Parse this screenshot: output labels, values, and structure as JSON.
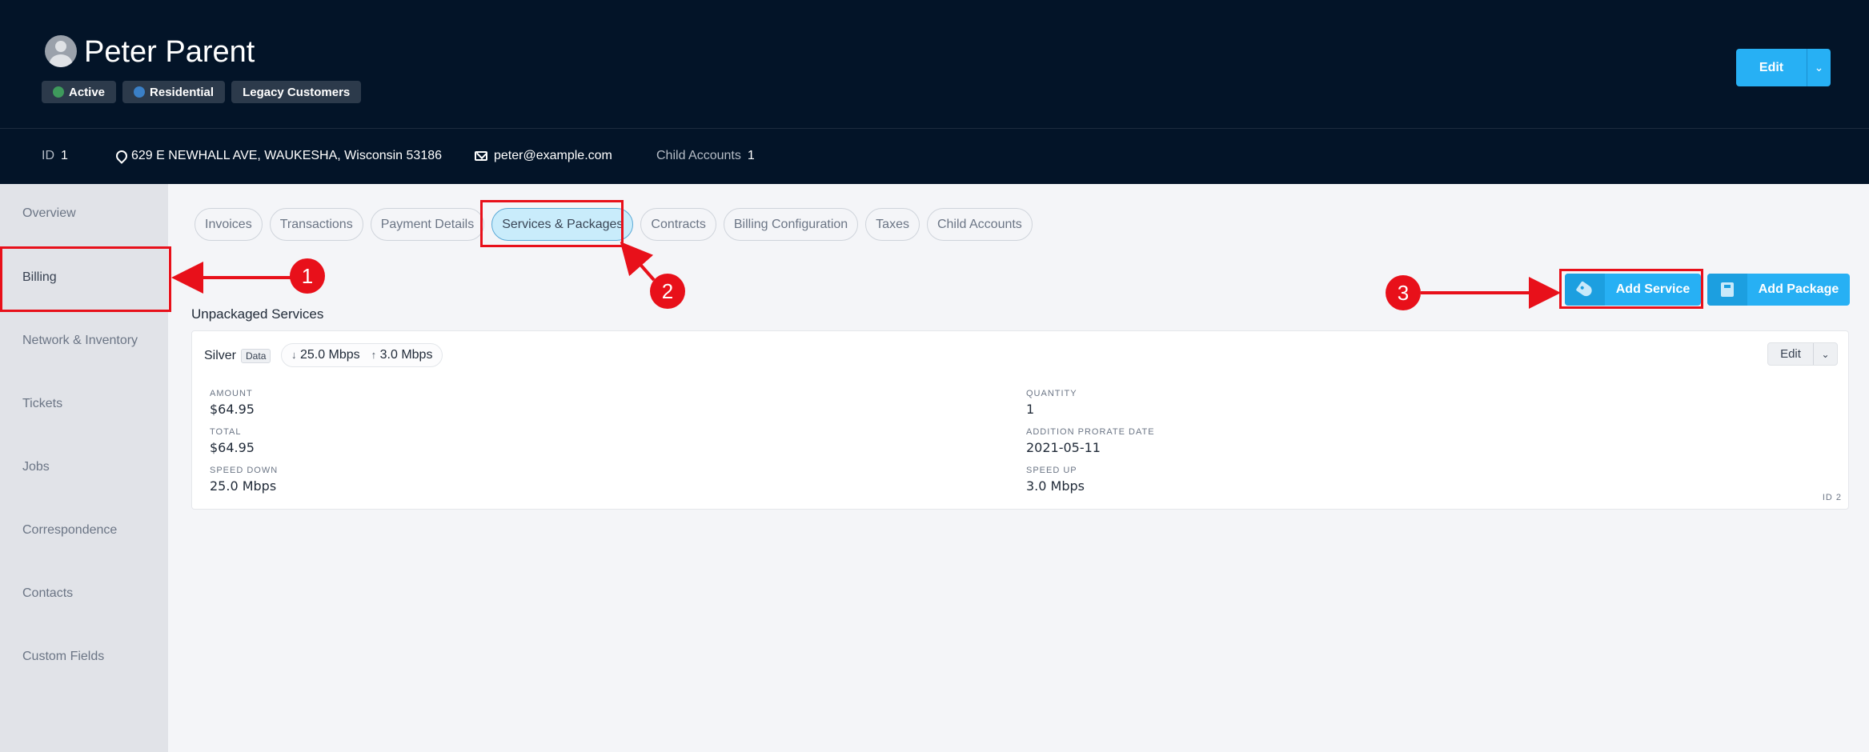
{
  "header": {
    "customer_name": "Peter Parent",
    "badges": [
      "Active",
      "Residential",
      "Legacy Customers"
    ],
    "edit_label": "Edit"
  },
  "info_bar": {
    "id_label": "ID",
    "id_value": "1",
    "address": "629 E NEWHALL AVE, WAUKESHA, Wisconsin 53186",
    "email": "peter@example.com",
    "child_accounts_label": "Child Accounts",
    "child_accounts_value": "1"
  },
  "sidebar": {
    "items": [
      "Overview",
      "Billing",
      "Network & Inventory",
      "Tickets",
      "Jobs",
      "Correspondence",
      "Contacts",
      "Custom Fields"
    ],
    "active": "Billing"
  },
  "tabs": [
    "Invoices",
    "Transactions",
    "Payment Details",
    "Services & Packages",
    "Contracts",
    "Billing Configuration",
    "Taxes",
    "Child Accounts"
  ],
  "active_tab": "Services & Packages",
  "actions": {
    "add_service": "Add Service",
    "add_package": "Add Package"
  },
  "section": {
    "title": "Unpackaged Services",
    "service": {
      "name": "Silver",
      "type_tag": "Data",
      "speed_down": "25.0 Mbps",
      "speed_up": "3.0 Mbps",
      "edit_label": "Edit",
      "fields": {
        "amount_label": "AMOUNT",
        "amount": "$64.95",
        "quantity_label": "QUANTITY",
        "quantity": "1",
        "total_label": "TOTAL",
        "total": "$64.95",
        "prorate_label": "ADDITION PRORATE DATE",
        "prorate": "2021-05-11",
        "speed_down_label": "SPEED DOWN",
        "speed_down": "25.0 Mbps",
        "speed_up_label": "SPEED UP",
        "speed_up": "3.0 Mbps"
      },
      "id_text": "ID 2"
    }
  },
  "annotations": [
    "1",
    "2",
    "3"
  ],
  "colors": {
    "header_bg": "#031428",
    "accent": "#27b0f4",
    "annotation_red": "#e8101a"
  }
}
